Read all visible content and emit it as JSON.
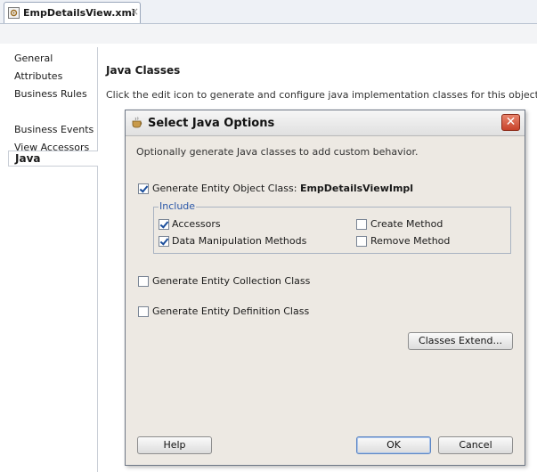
{
  "editor_tab": {
    "file_name": "EmpDetailsView.xml",
    "close_glyph": "×"
  },
  "nav": {
    "items": [
      {
        "label": "General"
      },
      {
        "label": "Attributes"
      },
      {
        "label": "Business Rules"
      },
      {
        "label": "Java"
      },
      {
        "label": "Business Events"
      },
      {
        "label": "View Accessors"
      }
    ],
    "selected": "Java"
  },
  "main": {
    "heading": "Java Classes",
    "description": "Click the edit icon to generate and configure java implementation classes for this object."
  },
  "dialog": {
    "title": "Select Java Options",
    "close_glyph": "✕",
    "intro": "Optionally generate Java classes to add custom behavior.",
    "generate_entity_object": {
      "prefix": "Generate Entity Object Class: ",
      "class_name": "EmpDetailsViewImpl",
      "checked": true
    },
    "include": {
      "title": "Include",
      "accessors": {
        "label": "Accessors",
        "checked": true
      },
      "data_manipulation": {
        "label": "Data Manipulation Methods",
        "checked": true
      },
      "create_method": {
        "label": "Create Method",
        "checked": false
      },
      "remove_method": {
        "label": "Remove Method",
        "checked": false
      }
    },
    "generate_collection": {
      "label": "Generate Entity Collection Class",
      "checked": false
    },
    "generate_definition": {
      "label": "Generate Entity Definition Class",
      "checked": false
    },
    "classes_extend_label": "Classes Extend...",
    "help_label": "Help",
    "ok_label": "OK",
    "cancel_label": "Cancel"
  },
  "colors": {
    "dialog_bg": "#ede9e3",
    "close_red": "#c8422a",
    "group_title_blue": "#2a57a8",
    "check_blue": "#1b4e9c"
  }
}
